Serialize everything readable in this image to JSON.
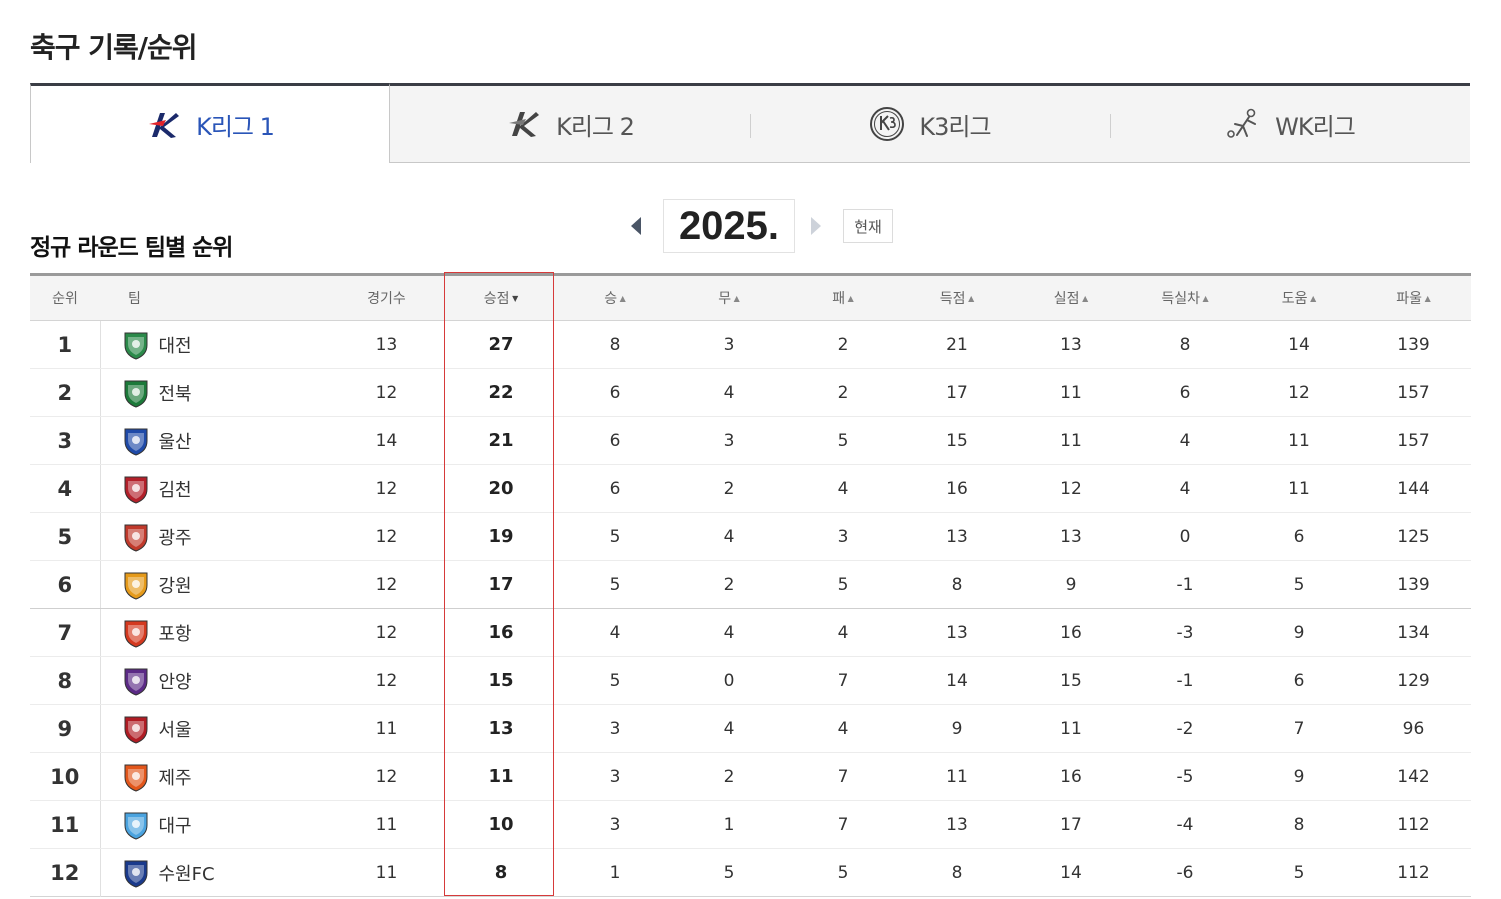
{
  "page": {
    "title": "축구 기록/순위"
  },
  "tabs": [
    {
      "label": "K리그 1",
      "logo": "kleague1-logo",
      "active": true
    },
    {
      "label": "K리그 2",
      "logo": "kleague2-logo",
      "active": false
    },
    {
      "label": "K3리그",
      "logo": "k3league-logo",
      "active": false
    },
    {
      "label": "WK리그",
      "logo": "wkleague-logo",
      "active": false
    }
  ],
  "section": {
    "title": "정규 라운드 팀별 순위",
    "year": "2025.",
    "current_label": "현재"
  },
  "table": {
    "headers": {
      "rank": "순위",
      "team": "팀",
      "games": "경기수",
      "points": "승점",
      "wins": "승",
      "draws": "무",
      "losses": "패",
      "goals_for": "득점",
      "goals_against": "실점",
      "goal_diff": "득실차",
      "assists": "도움",
      "fouls": "파울"
    },
    "sorted_by": "points",
    "rows": [
      {
        "rank": "1",
        "team": "대전",
        "crest_color": "#2b8a4a",
        "games": "13",
        "points": "27",
        "wins": "8",
        "draws": "3",
        "losses": "2",
        "goals_for": "21",
        "goals_against": "13",
        "goal_diff": "8",
        "assists": "14",
        "fouls": "139"
      },
      {
        "rank": "2",
        "team": "전북",
        "crest_color": "#1c7a3a",
        "games": "12",
        "points": "22",
        "wins": "6",
        "draws": "4",
        "losses": "2",
        "goals_for": "17",
        "goals_against": "11",
        "goal_diff": "6",
        "assists": "12",
        "fouls": "157"
      },
      {
        "rank": "3",
        "team": "울산",
        "crest_color": "#1f4aa8",
        "games": "14",
        "points": "21",
        "wins": "6",
        "draws": "3",
        "losses": "5",
        "goals_for": "15",
        "goals_against": "11",
        "goal_diff": "4",
        "assists": "11",
        "fouls": "157"
      },
      {
        "rank": "4",
        "team": "김천",
        "crest_color": "#b3202a",
        "games": "12",
        "points": "20",
        "wins": "6",
        "draws": "2",
        "losses": "4",
        "goals_for": "16",
        "goals_against": "12",
        "goal_diff": "4",
        "assists": "11",
        "fouls": "144"
      },
      {
        "rank": "5",
        "team": "광주",
        "crest_color": "#c0392b",
        "games": "12",
        "points": "19",
        "wins": "5",
        "draws": "4",
        "losses": "3",
        "goals_for": "13",
        "goals_against": "13",
        "goal_diff": "0",
        "assists": "6",
        "fouls": "125"
      },
      {
        "rank": "6",
        "team": "강원",
        "crest_color": "#e59a1a",
        "games": "12",
        "points": "17",
        "wins": "5",
        "draws": "2",
        "losses": "5",
        "goals_for": "8",
        "goals_against": "9",
        "goal_diff": "-1",
        "assists": "5",
        "fouls": "139"
      },
      {
        "rank": "7",
        "team": "포항",
        "crest_color": "#d4391f",
        "games": "12",
        "points": "16",
        "wins": "4",
        "draws": "4",
        "losses": "4",
        "goals_for": "13",
        "goals_against": "16",
        "goal_diff": "-3",
        "assists": "9",
        "fouls": "134"
      },
      {
        "rank": "8",
        "team": "안양",
        "crest_color": "#5b2a86",
        "games": "12",
        "points": "15",
        "wins": "5",
        "draws": "0",
        "losses": "7",
        "goals_for": "14",
        "goals_against": "15",
        "goal_diff": "-1",
        "assists": "6",
        "fouls": "129"
      },
      {
        "rank": "9",
        "team": "서울",
        "crest_color": "#b01c24",
        "games": "11",
        "points": "13",
        "wins": "3",
        "draws": "4",
        "losses": "4",
        "goals_for": "9",
        "goals_against": "11",
        "goal_diff": "-2",
        "assists": "7",
        "fouls": "96"
      },
      {
        "rank": "10",
        "team": "제주",
        "crest_color": "#e2561b",
        "games": "12",
        "points": "11",
        "wins": "3",
        "draws": "2",
        "losses": "7",
        "goals_for": "11",
        "goals_against": "16",
        "goal_diff": "-5",
        "assists": "9",
        "fouls": "142"
      },
      {
        "rank": "11",
        "team": "대구",
        "crest_color": "#4aa3df",
        "games": "11",
        "points": "10",
        "wins": "3",
        "draws": "1",
        "losses": "7",
        "goals_for": "13",
        "goals_against": "17",
        "goal_diff": "-4",
        "assists": "8",
        "fouls": "112"
      },
      {
        "rank": "12",
        "team": "수원FC",
        "crest_color": "#1a3a8c",
        "games": "11",
        "points": "8",
        "wins": "1",
        "draws": "5",
        "losses": "5",
        "goals_for": "8",
        "goals_against": "14",
        "goal_diff": "-6",
        "assists": "5",
        "fouls": "112"
      }
    ]
  },
  "colors": {
    "active_tab_text": "#2a55b8",
    "highlight_border": "#d63a3a"
  }
}
